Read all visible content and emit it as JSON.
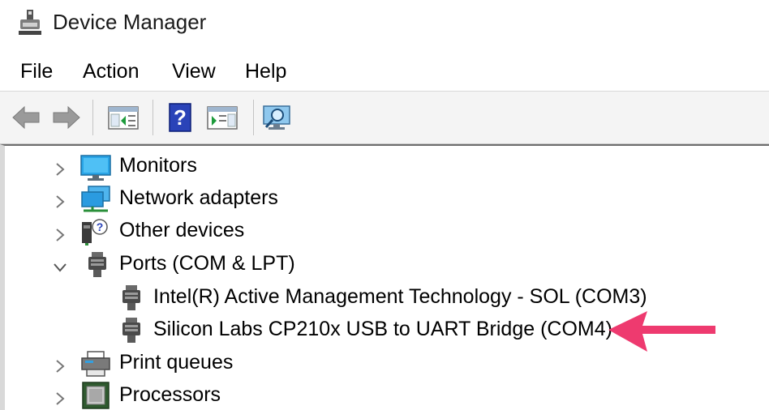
{
  "window": {
    "title": "Device Manager",
    "icon": "device-manager-icon"
  },
  "menu": {
    "items": [
      "File",
      "Action",
      "View",
      "Help"
    ]
  },
  "toolbar": {
    "buttons": [
      {
        "name": "back",
        "icon": "back-arrow-icon"
      },
      {
        "name": "forward",
        "icon": "forward-arrow-icon"
      },
      {
        "name": "show-hide-console-tree",
        "icon": "console-tree-icon"
      },
      {
        "name": "help",
        "icon": "help-icon"
      },
      {
        "name": "show-hide-action-pane",
        "icon": "action-pane-icon"
      },
      {
        "name": "scan-for-hardware-changes",
        "icon": "scan-monitor-icon"
      }
    ]
  },
  "tree": {
    "items": [
      {
        "label": "Monitors",
        "icon": "monitor-icon",
        "expanded": false,
        "level": 0
      },
      {
        "label": "Network adapters",
        "icon": "network-adapter-icon",
        "expanded": false,
        "level": 0
      },
      {
        "label": "Other devices",
        "icon": "other-devices-icon",
        "expanded": false,
        "level": 0
      },
      {
        "label": "Ports (COM & LPT)",
        "icon": "port-icon",
        "expanded": true,
        "level": 0
      },
      {
        "label": "Intel(R) Active Management Technology - SOL (COM3)",
        "icon": "port-icon",
        "level": 1
      },
      {
        "label": "Silicon Labs CP210x USB to UART Bridge (COM4)",
        "icon": "port-icon",
        "level": 1
      },
      {
        "label": "Print queues",
        "icon": "printer-icon",
        "expanded": false,
        "level": 0
      },
      {
        "label": "Processors",
        "icon": "processor-icon",
        "expanded": false,
        "level": 0
      }
    ]
  },
  "annotation": {
    "color": "#ee3a6f",
    "icon": "pink-arrow-pointing-left"
  }
}
